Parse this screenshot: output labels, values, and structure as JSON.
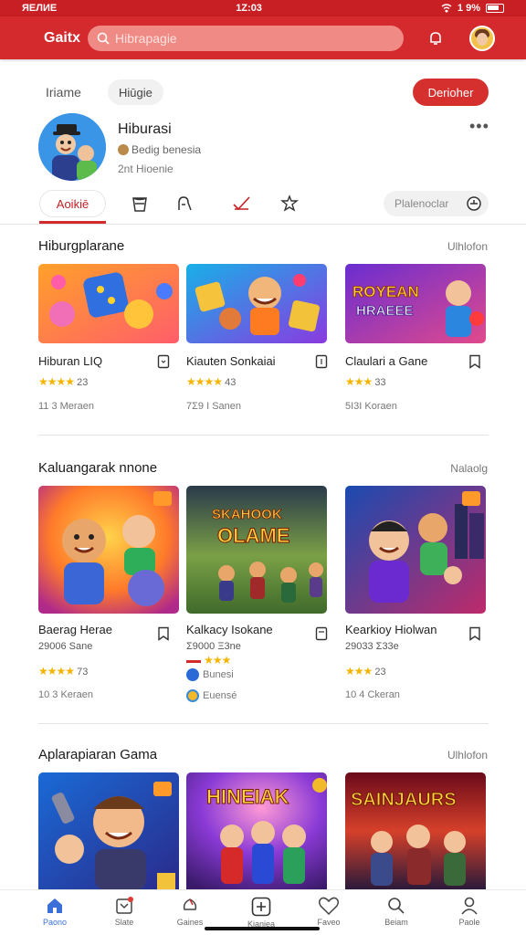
{
  "status": {
    "time_left": "ЯЕЛИЕ",
    "time_center": "1Z:03",
    "battery": "1 9%"
  },
  "appbar": {
    "title": "Gaitx",
    "search_placeholder": "Hibrapagie"
  },
  "top": {
    "plain_label": "Iriame",
    "chip_label": "Hiūgie",
    "cta_label": "Derioher"
  },
  "profile": {
    "name": "Hiburasi",
    "subtitle": "Bedig benesia",
    "followers": "2nt Hioenie",
    "more": "•••"
  },
  "tabs": {
    "active_label": "Aoikiē",
    "sort_label": "Plalenoclar"
  },
  "sections": [
    {
      "title": "Hiburgplarane",
      "link": "Ulhlofon",
      "cards": [
        {
          "title": "Hiburan LIQ",
          "stars": "★★★★",
          "rating": "23",
          "meta": "11 3 Meraen"
        },
        {
          "title": "Kiauten Sonkaiai",
          "stars": "★★★★",
          "rating": "43",
          "meta": "7Σ9 I Sanen"
        },
        {
          "title": "Claulari a Gane",
          "stars": "★★★",
          "rating": "33",
          "meta": "5I3I Koraen"
        }
      ]
    },
    {
      "title": "Kaluangarak nnone",
      "link": "Nalaolg",
      "cards": [
        {
          "title": "Baerag Herae",
          "sub": "29006 Sane",
          "stars": "★★★★",
          "rating": "73",
          "meta": "10 3 Keraen"
        },
        {
          "title": "Kalkacy Isokane",
          "sub": "Σ9000 Ξ3ne",
          "stars": "★★★",
          "rating": "",
          "meta": "Bunesi",
          "meta2": "Euensé"
        },
        {
          "title": "Kearkioy Hiolwan",
          "sub": "29033 Σ33e",
          "stars": "★★★",
          "rating": "23",
          "meta": "10 4 Ckeran"
        }
      ]
    },
    {
      "title": "Aplarapiaran Gama",
      "link": "Ulhlofon",
      "cards": [
        {
          "title": ""
        },
        {
          "title": "HINEIAK"
        },
        {
          "title": "SAINJAURS"
        }
      ]
    }
  ],
  "art": {
    "card_2_2": "SKAHOOK OLAME",
    "card_1_3": "ROYEAN HRAEEE"
  },
  "nav": [
    {
      "label": "Paono"
    },
    {
      "label": "Slate"
    },
    {
      "label": "Gaines"
    },
    {
      "label": "Kianiea"
    },
    {
      "label": "Faveo"
    },
    {
      "label": "Beiam"
    },
    {
      "label": "Paole"
    }
  ],
  "colors": {
    "brand_red": "#d42a2e",
    "star": "#f4b400",
    "nav_active": "#3b6fd8"
  }
}
